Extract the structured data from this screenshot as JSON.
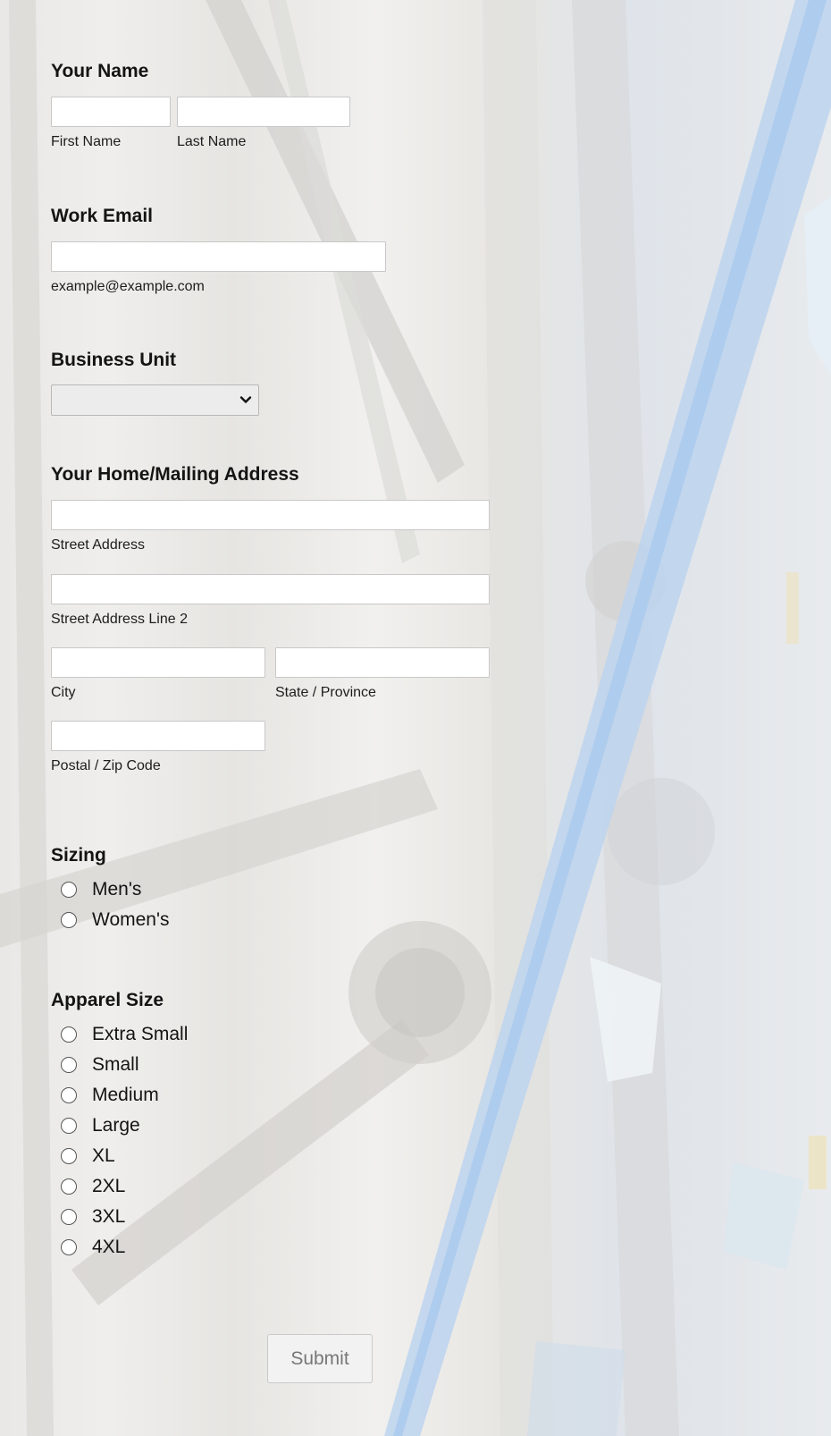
{
  "name_section": {
    "label": "Your Name",
    "first_sublabel": "First Name",
    "last_sublabel": "Last Name",
    "first_value": "",
    "last_value": ""
  },
  "email_section": {
    "label": "Work Email",
    "sublabel": "example@example.com",
    "value": ""
  },
  "business_unit": {
    "label": "Business Unit",
    "selected": ""
  },
  "address_section": {
    "label": "Your Home/Mailing Address",
    "street_sublabel": "Street Address",
    "street2_sublabel": "Street Address Line 2",
    "city_sublabel": "City",
    "state_sublabel": "State / Province",
    "postal_sublabel": "Postal / Zip Code"
  },
  "sizing": {
    "label": "Sizing",
    "options": [
      "Men's",
      "Women's"
    ]
  },
  "apparel_size": {
    "label": "Apparel Size",
    "options": [
      "Extra Small",
      "Small",
      "Medium",
      "Large",
      "XL",
      "2XL",
      "3XL",
      "4XL"
    ]
  },
  "submit_label": "Submit",
  "icons": {
    "select_arrow": "chevron-down-icon"
  }
}
